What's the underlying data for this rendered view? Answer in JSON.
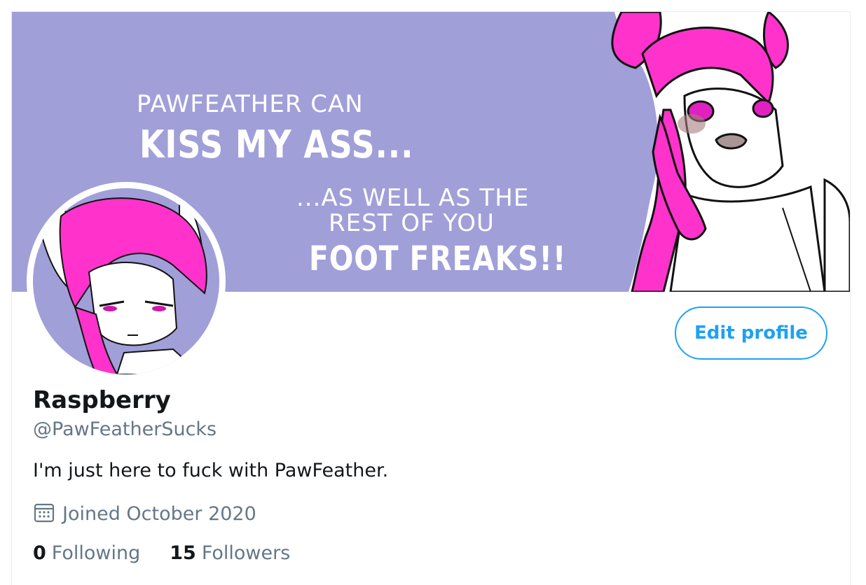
{
  "banner": {
    "line1": "PAWFEATHER CAN",
    "line2": "KISS MY ASS...",
    "line3": "...AS WELL AS THE",
    "line4": "REST OF YOU",
    "line5": "FOOT FREAKS!!",
    "background_color": "#a09fd8",
    "character_color": "#ff33cc"
  },
  "profile": {
    "name": "Raspberry",
    "handle": "@PawFeatherSucks",
    "bio": "I'm just here to fuck with PawFeather.",
    "joined": "Joined October 2020",
    "joined_icon": "calendar-icon"
  },
  "actions": {
    "edit_profile": "Edit profile"
  },
  "stats": {
    "following_count": "0",
    "following_label": "Following",
    "followers_count": "15",
    "followers_label": "Followers"
  },
  "colors": {
    "accent": "#1da1f2",
    "secondary_text": "#657786",
    "primary_text": "#14171a"
  }
}
